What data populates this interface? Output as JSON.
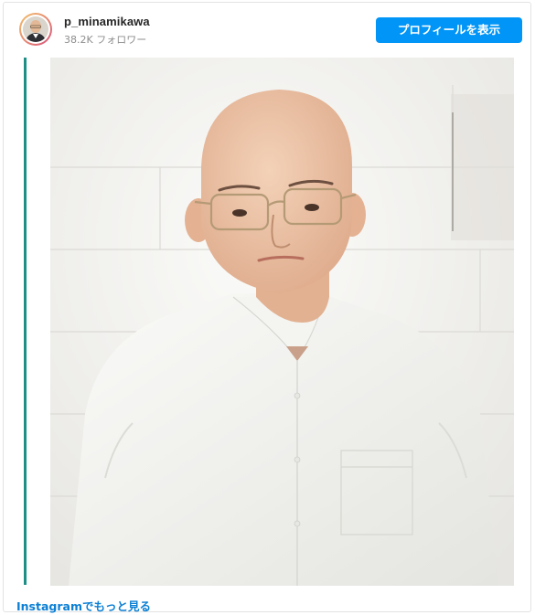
{
  "post": {
    "username": "p_minamikawa",
    "followers": "38.2K フォロワー",
    "profile_button_label": "プロフィールを表示",
    "more_link_label": "Instagramでもっと見る"
  },
  "photo": {
    "subject": "person-portrait",
    "background_color": "#f1f1ef",
    "shirt_color": "#f7f7f4",
    "accent_bar_color": "#1f8f86"
  },
  "icons": {
    "avatar": "avatar-icon"
  },
  "colors": {
    "button": "#0095f6",
    "link": "#0b7fd4",
    "username": "#262626",
    "followers": "#8e8e8e"
  }
}
